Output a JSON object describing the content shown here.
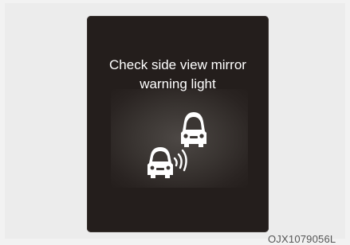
{
  "display": {
    "line1": "Check side view mirror",
    "line2": "warning light",
    "icon": "blind-spot-warning-icon"
  },
  "figure_code": "OJX1079056L",
  "colors": {
    "display_bg": "#241e1c",
    "text": "#ffffff",
    "page_bg": "#f2f2f2"
  }
}
